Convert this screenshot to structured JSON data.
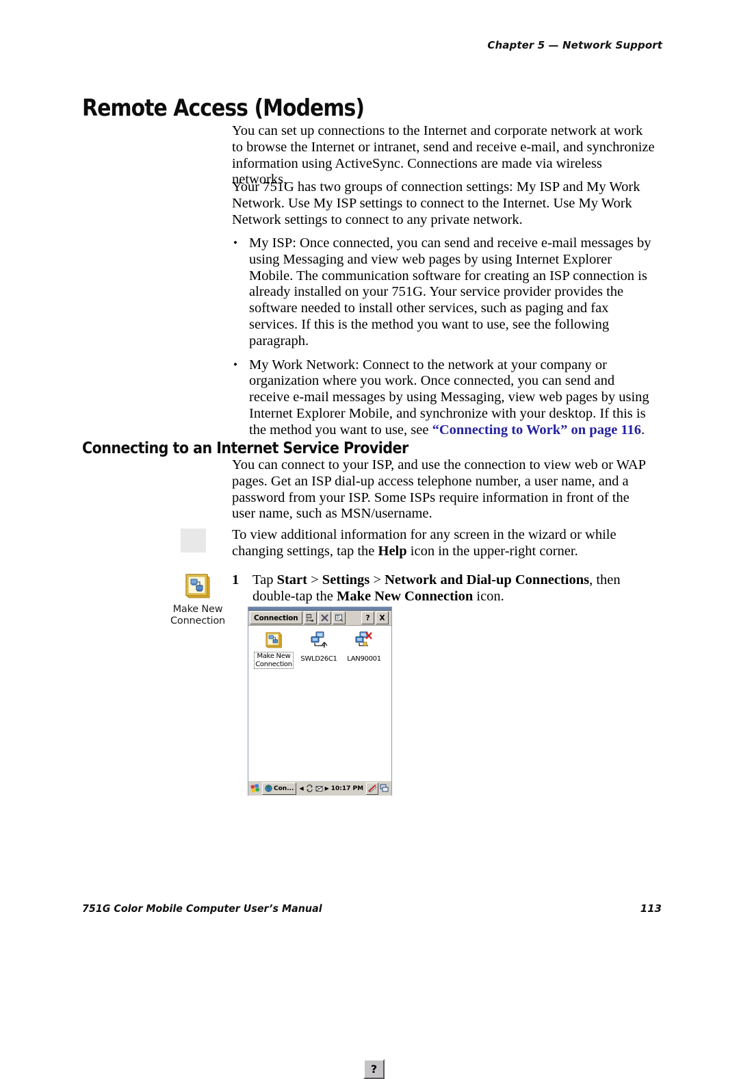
{
  "running_head": "Chapter 5 —  Network Support",
  "headings": {
    "h1": "Remote Access (Modems)",
    "h2": "Connecting to an Internet Service Provider"
  },
  "paragraphs": {
    "p1": "You can set up connections to the Internet and corporate network at work to browse the Internet or intranet, send and receive e-mail, and synchronize information using ActiveSync. Connections are made via wireless networks.",
    "p2": "Your 751G has two groups of connection settings: My ISP and My Work Network. Use My ISP settings to connect to the Internet. Use My Work Network settings to connect to any private network.",
    "p3": "You can connect to your ISP, and use the connection to view web or WAP pages. Get an ISP dial-up access telephone number, a user name, and a password from your ISP. Some ISPs require information in front of the user name, such as MSN/username.",
    "p4_part1": "To view additional information for any screen in the wizard or while changing settings, tap the ",
    "p4_bold": "Help",
    "p4_part2": " icon in the upper-right corner."
  },
  "bullets": [
    {
      "marker": "•",
      "text": "My ISP: Once connected, you can send and receive e-mail messages by using Messaging and view web pages by using Internet Explorer Mobile. The communication software for creating an ISP connection is already installed on your 751G. Your service provider provides the software needed to install other services, such as paging and fax services. If this is the method you want to use, see the following paragraph."
    },
    {
      "marker": "•",
      "text_part1": "My Work Network: Connect to the network at your company or organization where you work. Once connected, you can send and receive e-mail messages by using Messaging, view web pages by using Internet Explorer Mobile, and synchronize with your desktop. If this is the method you want to use, see ",
      "xref": "“Connecting to Work” on page 116",
      "text_part2": "."
    }
  ],
  "step": {
    "number": "1",
    "part1": "Tap ",
    "bold1": "Start",
    "sep1": " > ",
    "bold2": "Settings",
    "sep2": " > ",
    "bold3": "Network and Dial-up Connections",
    "part2": ", then double-tap the ",
    "bold4": "Make New Connection",
    "part3": " icon."
  },
  "help_icon": {
    "glyph": "?",
    "name": "help-icon"
  },
  "margin_icon": {
    "label_line1": "Make New",
    "label_line2": "Connection"
  },
  "device": {
    "titlebar": {
      "menu": "Connection",
      "buttons": [
        "rename-icon",
        "delete-icon",
        "properties-icon"
      ],
      "help": "?",
      "close": "X"
    },
    "desktop_items": [
      {
        "label_line1": "Make New",
        "label_line2": "Connection",
        "icon": "make-new-connection-icon",
        "selected": true
      },
      {
        "label_line1": "SWLD26C1",
        "label_line2": "",
        "icon": "wireless-connection-icon",
        "selected": false
      },
      {
        "label_line1": "LAN90001",
        "label_line2": "",
        "icon": "lan-disconnected-icon",
        "selected": false
      }
    ],
    "taskbar": {
      "start": "start-flag-icon",
      "task_label": "Con...",
      "task_icon": "globe-icon",
      "tray_icons": [
        "left-arrow-icon",
        "activesync-icon",
        "envelope-icon",
        "right-arrow-icon"
      ],
      "clock": "10:17 PM",
      "tray_right": [
        "no-signal-icon",
        "network-icon"
      ]
    }
  },
  "footer": {
    "left": "751G Color Mobile Computer User’s Manual",
    "right": "113"
  }
}
